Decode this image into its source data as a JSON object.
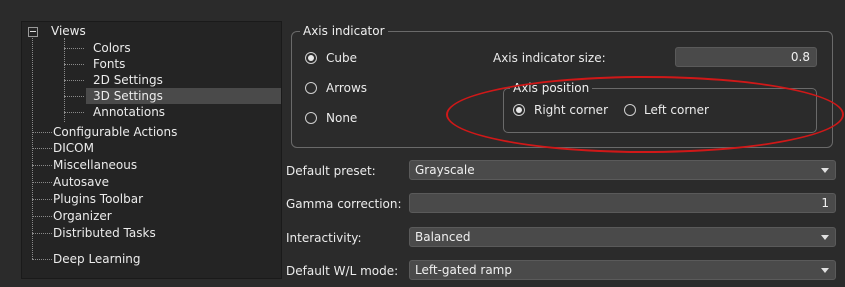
{
  "tree": {
    "root": "Views",
    "children": [
      "Colors",
      "Fonts",
      "2D Settings",
      "3D Settings",
      "Annotations"
    ],
    "selected": "3D Settings",
    "items": [
      "Configurable Actions",
      "DICOM",
      "Miscellaneous",
      "Autosave",
      "Plugins Toolbar",
      "Organizer",
      "Distributed Tasks",
      "Deep Learning"
    ]
  },
  "axis_indicator": {
    "title": "Axis indicator",
    "options": [
      "Cube",
      "Arrows",
      "None"
    ],
    "selected": "Cube",
    "size_label": "Axis indicator size:",
    "size_value": "0.8"
  },
  "axis_position": {
    "title": "Axis position",
    "options": [
      "Right corner",
      "Left corner"
    ],
    "selected": "Right corner"
  },
  "settings": {
    "default_preset_label": "Default preset:",
    "default_preset_value": "Grayscale",
    "gamma_label": "Gamma correction:",
    "gamma_value": "1",
    "interactivity_label": "Interactivity:",
    "interactivity_value": "Balanced",
    "wl_label": "Default W/L mode:",
    "wl_value": "Left-gated ramp"
  },
  "colors": {
    "background": "#2b2b2b",
    "highlight_ellipse": "#d01818",
    "field": "#4a4a4a"
  }
}
